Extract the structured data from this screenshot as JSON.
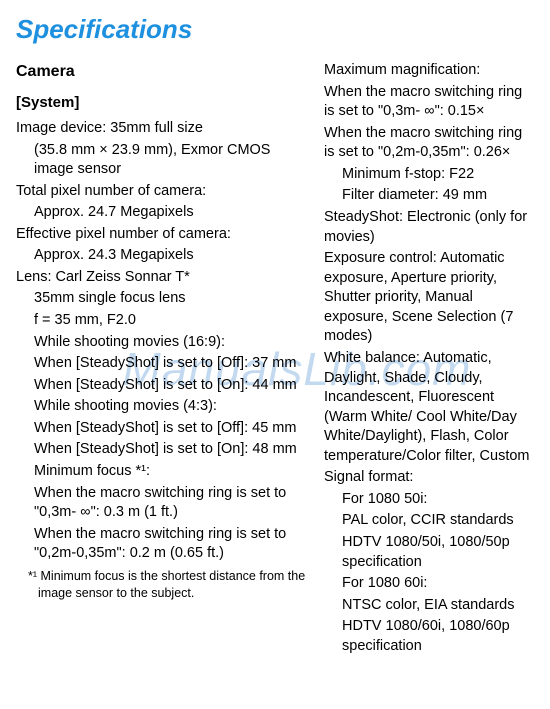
{
  "watermark": "ManualsLib.com",
  "title": "Specifications",
  "camera_heading": "Camera",
  "system_heading": "[System]",
  "left": {
    "image_device_label": "Image device: 35mm full size",
    "image_device_detail": "(35.8 mm × 23.9 mm), Exmor CMOS image sensor",
    "total_pixel_label": "Total pixel number of camera:",
    "total_pixel_value": "Approx. 24.7 Megapixels",
    "effective_pixel_label": "Effective pixel number of camera:",
    "effective_pixel_value": "Approx. 24.3 Megapixels",
    "lens_label": "Lens: Carl Zeiss Sonnar T*",
    "lens_focus": "35mm single focus lens",
    "lens_f": "f = 35 mm, F2.0",
    "movies_169": "While shooting movies (16:9):",
    "ss_off_169a": "When [SteadyShot] is set to [Off]: 37 mm",
    "ss_on_169a": "When [SteadyShot] is set to [On]: 44 mm",
    "movies_43": "While shooting movies (4:3):",
    "ss_off_43a": "When [SteadyShot] is set to [Off]: 45 mm",
    "ss_on_43a": "When [SteadyShot] is set to [On]: 48 mm",
    "min_focus_label": "Minimum focus *¹:",
    "min_focus_1": "When the macro switching ring is set to \"0,3m-   ∞\": 0.3 m (1 ft.)",
    "min_focus_2": "When the macro switching ring is set to \"0,2m-0,35m\": 0.2 m (0.65 ft.)",
    "footnote": "*¹ Minimum focus is the shortest distance from the image sensor to the subject."
  },
  "right": {
    "max_mag_label": "Maximum magnification:",
    "max_mag_1": "When the macro switching ring is set to \"0,3m-   ∞\": 0.15×",
    "max_mag_2": "When the macro switching ring is set to \"0,2m-0,35m\": 0.26×",
    "min_fstop": "Minimum f-stop: F22",
    "filter": "Filter diameter: 49 mm",
    "steadyshot": "SteadyShot: Electronic (only for movies)",
    "exposure": "Exposure control: Automatic exposure, Aperture priority, Shutter priority, Manual exposure, Scene Selection (7 modes)",
    "white_balance": "White balance: Automatic, Daylight, Shade, Cloudy, Incandescent, Fluorescent (Warm White/ Cool White/Day White/Daylight), Flash, Color temperature/Color filter, Custom",
    "signal_label": "Signal format:",
    "signal_50i_a": "For 1080 50i:",
    "signal_50i_b": "PAL color, CCIR standards",
    "signal_50i_c": "HDTV 1080/50i, 1080/50p specification",
    "signal_60i_a": "For 1080 60i:",
    "signal_60i_b": "NTSC color, EIA standards",
    "signal_60i_c": "HDTV 1080/60i, 1080/60p specification"
  }
}
